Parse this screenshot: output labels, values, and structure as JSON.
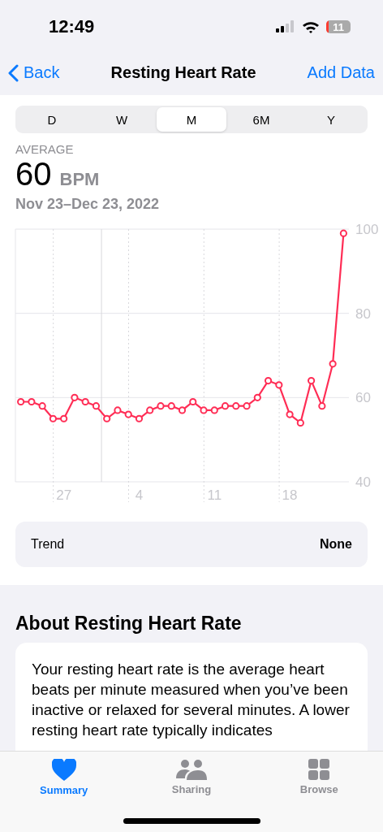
{
  "status_bar": {
    "time": "12:49",
    "battery": "11"
  },
  "nav": {
    "back": "Back",
    "title": "Resting Heart Rate",
    "action": "Add Data"
  },
  "ranges": [
    {
      "label": "D",
      "selected": false
    },
    {
      "label": "W",
      "selected": false
    },
    {
      "label": "M",
      "selected": true
    },
    {
      "label": "6M",
      "selected": false
    },
    {
      "label": "Y",
      "selected": false
    }
  ],
  "summary": {
    "label": "AVERAGE",
    "value": "60",
    "unit": "BPM",
    "date_range": "Nov 23–Dec 23, 2022"
  },
  "chart_data": {
    "type": "line",
    "categories": [
      null,
      null,
      null,
      null,
      "27",
      null,
      null,
      null,
      null,
      null,
      null,
      "4",
      null,
      null,
      null,
      null,
      null,
      null,
      "11",
      null,
      null,
      null,
      null,
      null,
      null,
      "18",
      null,
      null,
      null,
      null,
      null
    ],
    "series": [
      {
        "color": "#ff2d55",
        "marker": "circle",
        "values": [
          59,
          59,
          58,
          55,
          55,
          60,
          59,
          58,
          55,
          57,
          56,
          55,
          57,
          58,
          58,
          57,
          59,
          57,
          57,
          58,
          58,
          58,
          60,
          64,
          63,
          56,
          54,
          64,
          58,
          68,
          99
        ]
      }
    ],
    "ylim": [
      40,
      100
    ],
    "grid": true,
    "yticks": [
      40,
      60,
      80,
      100
    ]
  },
  "trend": {
    "label": "Trend",
    "value": "None"
  },
  "about": {
    "title": "About Resting Heart Rate",
    "text": "Your resting heart rate is the average heart beats per minute measured when you’ve been inactive or relaxed for several minutes. A lower resting heart rate typically indicates"
  },
  "tab_bar": [
    {
      "label": "Summary",
      "kind": "heart",
      "selected": true
    },
    {
      "label": "Sharing",
      "kind": "people",
      "selected": false
    },
    {
      "label": "Browse",
      "kind": "grid",
      "selected": false
    }
  ]
}
